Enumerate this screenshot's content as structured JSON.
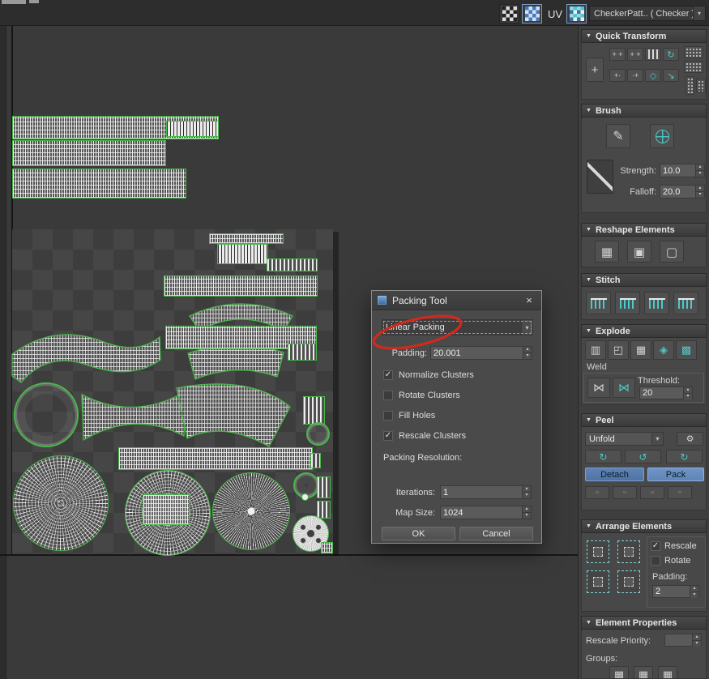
{
  "toolbar": {
    "uv_label": "UV",
    "material_dropdown": "CheckerPatt.. ( Checker )"
  },
  "panel": {
    "quick_transform": {
      "title": "Quick Transform"
    },
    "brush": {
      "title": "Brush",
      "strength_label": "Strength:",
      "strength_value": "10.0",
      "falloff_label": "Falloff:",
      "falloff_value": "20.0"
    },
    "reshape": {
      "title": "Reshape Elements"
    },
    "stitch": {
      "title": "Stitch"
    },
    "explode": {
      "title": "Explode",
      "weld_label": "Weld",
      "threshold_label": "Threshold:",
      "threshold_value": "20"
    },
    "peel": {
      "title": "Peel",
      "mode_value": "Unfold",
      "detach_label": "Detach",
      "pack_label": "Pack"
    },
    "arrange": {
      "title": "Arrange Elements",
      "rescale_label": "Rescale",
      "rescale_checked": true,
      "rotate_label": "Rotate",
      "rotate_checked": false,
      "padding_label": "Padding:",
      "padding_value": "2"
    },
    "element_properties": {
      "title": "Element Properties",
      "rescale_priority_label": "Rescale Priority:",
      "groups_label": "Groups:"
    }
  },
  "dialog": {
    "title": "Packing Tool",
    "close_label": "×",
    "method_value": "Linear Packing",
    "padding_label": "Padding:",
    "padding_value": "20.001",
    "checkboxes": [
      {
        "label": "Normalize Clusters",
        "checked": true
      },
      {
        "label": "Rotate Clusters",
        "checked": false
      },
      {
        "label": "Fill Holes",
        "checked": false
      },
      {
        "label": "Rescale Clusters",
        "checked": true
      }
    ],
    "resolution_label": "Packing Resolution:",
    "iterations_label": "Iterations:",
    "iterations_value": "1",
    "map_size_label": "Map Size:",
    "map_size_value": "1024",
    "ok_label": "OK",
    "cancel_label": "Cancel"
  },
  "colors": {
    "wireframe_green": "#49b849",
    "accent_teal": "#4cc9c9",
    "selection_blue": "#6f97c9",
    "annotation_red": "#d3291c"
  }
}
